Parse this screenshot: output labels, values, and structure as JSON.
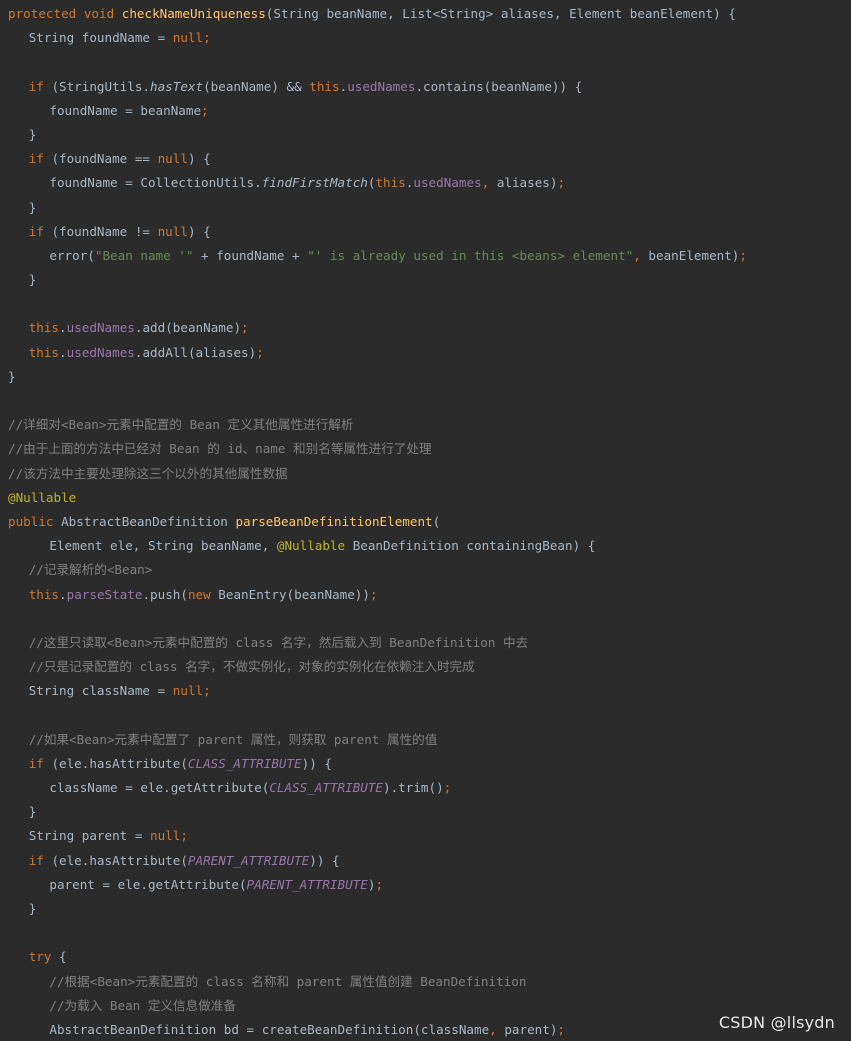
{
  "colors": {
    "background": "#2b2b2b",
    "keyword": "#cc7832",
    "method_declaration": "#ffc66d",
    "field": "#9876aa",
    "string": "#6a8759",
    "comment": "#808080",
    "annotation": "#bbb529",
    "default_text": "#a9b7c6"
  },
  "watermark": "CSDN @llsydn",
  "lines": [
    {
      "indent": 0,
      "tokens": [
        {
          "t": "protected void ",
          "c": "kw"
        },
        {
          "t": "checkNameUniqueness",
          "c": "fn"
        },
        {
          "t": "(String beanName, List<String> aliases, Element beanElement) {",
          "c": "plain"
        }
      ]
    },
    {
      "indent": 1,
      "tokens": [
        {
          "t": "String foundName = ",
          "c": "plain"
        },
        {
          "t": "null",
          "c": "kw"
        },
        {
          "t": ";",
          "c": "kw"
        }
      ]
    },
    {
      "indent": 0,
      "tokens": []
    },
    {
      "indent": 1,
      "tokens": [
        {
          "t": "if ",
          "c": "kw"
        },
        {
          "t": "(StringUtils.",
          "c": "plain"
        },
        {
          "t": "hasText",
          "c": "static"
        },
        {
          "t": "(beanName) && ",
          "c": "plain"
        },
        {
          "t": "this",
          "c": "kw"
        },
        {
          "t": ".",
          "c": "plain"
        },
        {
          "t": "usedNames",
          "c": "field"
        },
        {
          "t": ".contains(beanName)) {",
          "c": "plain"
        }
      ]
    },
    {
      "indent": 2,
      "tokens": [
        {
          "t": "foundName = beanName",
          "c": "plain"
        },
        {
          "t": ";",
          "c": "kw"
        }
      ]
    },
    {
      "indent": 1,
      "tokens": [
        {
          "t": "}",
          "c": "plain"
        }
      ]
    },
    {
      "indent": 1,
      "tokens": [
        {
          "t": "if ",
          "c": "kw"
        },
        {
          "t": "(foundName == ",
          "c": "plain"
        },
        {
          "t": "null",
          "c": "kw"
        },
        {
          "t": ") {",
          "c": "plain"
        }
      ]
    },
    {
      "indent": 2,
      "tokens": [
        {
          "t": "foundName = CollectionUtils.",
          "c": "plain"
        },
        {
          "t": "findFirstMatch",
          "c": "static"
        },
        {
          "t": "(",
          "c": "plain"
        },
        {
          "t": "this",
          "c": "kw"
        },
        {
          "t": ".",
          "c": "plain"
        },
        {
          "t": "usedNames",
          "c": "field"
        },
        {
          "t": ", ",
          "c": "kw"
        },
        {
          "t": "aliases)",
          "c": "plain"
        },
        {
          "t": ";",
          "c": "kw"
        }
      ]
    },
    {
      "indent": 1,
      "tokens": [
        {
          "t": "}",
          "c": "plain"
        }
      ]
    },
    {
      "indent": 1,
      "tokens": [
        {
          "t": "if ",
          "c": "kw"
        },
        {
          "t": "(foundName != ",
          "c": "plain"
        },
        {
          "t": "null",
          "c": "kw"
        },
        {
          "t": ") {",
          "c": "plain"
        }
      ]
    },
    {
      "indent": 2,
      "tokens": [
        {
          "t": "error(",
          "c": "plain"
        },
        {
          "t": "\"Bean name '\"",
          "c": "str"
        },
        {
          "t": " + foundName + ",
          "c": "plain"
        },
        {
          "t": "\"' is already used in this <beans> element\"",
          "c": "str"
        },
        {
          "t": ", ",
          "c": "kw"
        },
        {
          "t": "beanElement)",
          "c": "plain"
        },
        {
          "t": ";",
          "c": "kw"
        }
      ]
    },
    {
      "indent": 1,
      "tokens": [
        {
          "t": "}",
          "c": "plain"
        }
      ]
    },
    {
      "indent": 0,
      "tokens": []
    },
    {
      "indent": 1,
      "tokens": [
        {
          "t": "this",
          "c": "kw"
        },
        {
          "t": ".",
          "c": "plain"
        },
        {
          "t": "usedNames",
          "c": "field"
        },
        {
          "t": ".add(beanName)",
          "c": "plain"
        },
        {
          "t": ";",
          "c": "kw"
        }
      ]
    },
    {
      "indent": 1,
      "tokens": [
        {
          "t": "this",
          "c": "kw"
        },
        {
          "t": ".",
          "c": "plain"
        },
        {
          "t": "usedNames",
          "c": "field"
        },
        {
          "t": ".addAll(aliases)",
          "c": "plain"
        },
        {
          "t": ";",
          "c": "kw"
        }
      ]
    },
    {
      "indent": 0,
      "tokens": [
        {
          "t": "}",
          "c": "plain"
        }
      ]
    },
    {
      "indent": 0,
      "tokens": []
    },
    {
      "indent": 0,
      "tokens": [
        {
          "t": "//详细对<Bean>元素中配置的 Bean 定义其他属性进行解析",
          "c": "cmt"
        }
      ]
    },
    {
      "indent": 0,
      "tokens": [
        {
          "t": "//由于上面的方法中已经对 Bean 的 id、name 和别名等属性进行了处理",
          "c": "cmt"
        }
      ]
    },
    {
      "indent": 0,
      "tokens": [
        {
          "t": "//该方法中主要处理除这三个以外的其他属性数据",
          "c": "cmt"
        }
      ]
    },
    {
      "indent": 0,
      "tokens": [
        {
          "t": "@Nullable",
          "c": "ann"
        }
      ]
    },
    {
      "indent": 0,
      "tokens": [
        {
          "t": "public ",
          "c": "kw"
        },
        {
          "t": "AbstractBeanDefinition ",
          "c": "plain"
        },
        {
          "t": "parseBeanDefinitionElement",
          "c": "fn"
        },
        {
          "t": "(",
          "c": "plain"
        }
      ]
    },
    {
      "indent": 2,
      "tokens": [
        {
          "t": "Element ele, String beanName, ",
          "c": "plain"
        },
        {
          "t": "@Nullable ",
          "c": "ann"
        },
        {
          "t": "BeanDefinition containingBean) {",
          "c": "plain"
        }
      ]
    },
    {
      "indent": 1,
      "tokens": [
        {
          "t": "//记录解析的<Bean>",
          "c": "cmt"
        }
      ]
    },
    {
      "indent": 1,
      "tokens": [
        {
          "t": "this",
          "c": "kw"
        },
        {
          "t": ".",
          "c": "plain"
        },
        {
          "t": "parseState",
          "c": "field"
        },
        {
          "t": ".push(",
          "c": "plain"
        },
        {
          "t": "new ",
          "c": "kw"
        },
        {
          "t": "BeanEntry(beanName))",
          "c": "plain"
        },
        {
          "t": ";",
          "c": "kw"
        }
      ]
    },
    {
      "indent": 0,
      "tokens": []
    },
    {
      "indent": 1,
      "tokens": [
        {
          "t": "//这里只读取<Bean>元素中配置的 class 名字，然后载入到 BeanDefinition 中去",
          "c": "cmt"
        }
      ]
    },
    {
      "indent": 1,
      "tokens": [
        {
          "t": "//只是记录配置的 class 名字，不做实例化，对象的实例化在依赖注入时完成",
          "c": "cmt"
        }
      ]
    },
    {
      "indent": 1,
      "tokens": [
        {
          "t": "String className = ",
          "c": "plain"
        },
        {
          "t": "null",
          "c": "kw"
        },
        {
          "t": ";",
          "c": "kw"
        }
      ]
    },
    {
      "indent": 0,
      "tokens": []
    },
    {
      "indent": 1,
      "tokens": [
        {
          "t": "//如果<Bean>元素中配置了 parent 属性，则获取 parent 属性的值",
          "c": "cmt"
        }
      ]
    },
    {
      "indent": 1,
      "tokens": [
        {
          "t": "if ",
          "c": "kw"
        },
        {
          "t": "(ele.hasAttribute(",
          "c": "plain"
        },
        {
          "t": "CLASS_ATTRIBUTE",
          "c": "const"
        },
        {
          "t": ")) {",
          "c": "plain"
        }
      ]
    },
    {
      "indent": 2,
      "tokens": [
        {
          "t": "className = ele.getAttribute(",
          "c": "plain"
        },
        {
          "t": "CLASS_ATTRIBUTE",
          "c": "const"
        },
        {
          "t": ").trim()",
          "c": "plain"
        },
        {
          "t": ";",
          "c": "kw"
        }
      ]
    },
    {
      "indent": 1,
      "tokens": [
        {
          "t": "}",
          "c": "plain"
        }
      ]
    },
    {
      "indent": 1,
      "tokens": [
        {
          "t": "String parent = ",
          "c": "plain"
        },
        {
          "t": "null",
          "c": "kw"
        },
        {
          "t": ";",
          "c": "kw"
        }
      ]
    },
    {
      "indent": 1,
      "tokens": [
        {
          "t": "if ",
          "c": "kw"
        },
        {
          "t": "(ele.hasAttribute(",
          "c": "plain"
        },
        {
          "t": "PARENT_ATTRIBUTE",
          "c": "const"
        },
        {
          "t": ")) {",
          "c": "plain"
        }
      ]
    },
    {
      "indent": 2,
      "tokens": [
        {
          "t": "parent = ele.getAttribute(",
          "c": "plain"
        },
        {
          "t": "PARENT_ATTRIBUTE",
          "c": "const"
        },
        {
          "t": ")",
          "c": "plain"
        },
        {
          "t": ";",
          "c": "kw"
        }
      ]
    },
    {
      "indent": 1,
      "tokens": [
        {
          "t": "}",
          "c": "plain"
        }
      ]
    },
    {
      "indent": 0,
      "tokens": []
    },
    {
      "indent": 1,
      "tokens": [
        {
          "t": "try ",
          "c": "kw"
        },
        {
          "t": "{",
          "c": "plain"
        }
      ]
    },
    {
      "indent": 2,
      "tokens": [
        {
          "t": "//根据<Bean>元素配置的 class 名称和 parent 属性值创建 BeanDefinition",
          "c": "cmt"
        }
      ]
    },
    {
      "indent": 2,
      "tokens": [
        {
          "t": "//为载入 Bean 定义信息做准备",
          "c": "cmt"
        }
      ]
    },
    {
      "indent": 2,
      "tokens": [
        {
          "t": "AbstractBeanDefinition bd = createBeanDefinition(className",
          "c": "plain"
        },
        {
          "t": ", ",
          "c": "kw"
        },
        {
          "t": "parent)",
          "c": "plain"
        },
        {
          "t": ";",
          "c": "kw"
        }
      ]
    }
  ]
}
